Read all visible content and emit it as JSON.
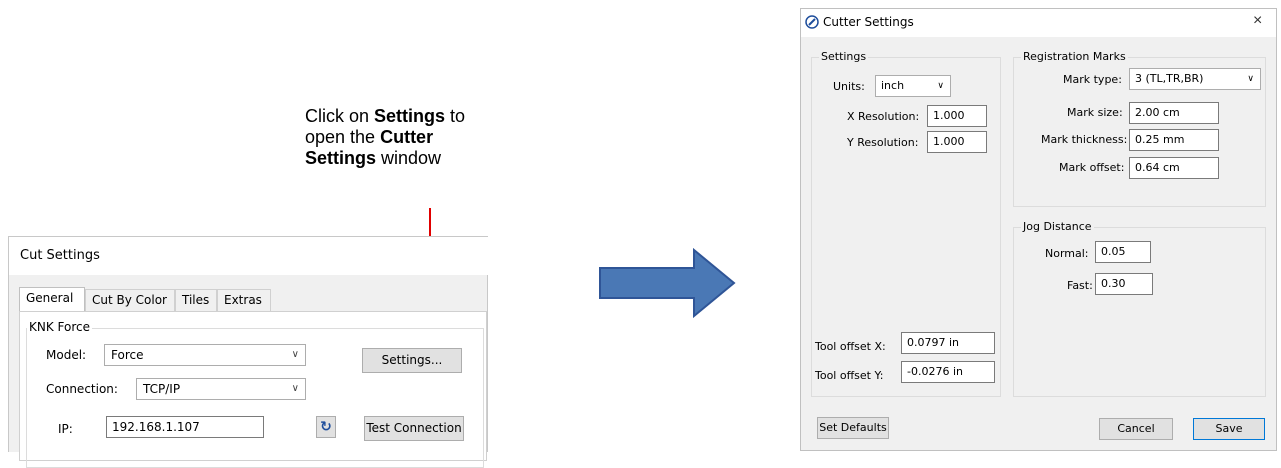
{
  "annotation": {
    "line1_pre": "Click on ",
    "line1_bold": "Settings",
    "line1_post": " to",
    "line2_pre": "open the ",
    "line2_bold": "Cutter",
    "line3_bold": "Settings",
    "line3_post": " window",
    "arrow_color": "#e00000"
  },
  "big_arrow_color": "#4a78b5",
  "cut_settings": {
    "title": "Cut Settings",
    "tabs": [
      "General",
      "Cut By Color",
      "Tiles",
      "Extras"
    ],
    "group_label": "KNK Force",
    "model_label": "Model:",
    "model_value": "Force",
    "settings_button": "Settings...",
    "connection_label": "Connection:",
    "connection_value": "TCP/IP",
    "ip_label": "IP:",
    "ip_value": "192.168.1.107",
    "refresh_icon": "refresh-icon",
    "test_button": "Test Connection"
  },
  "cutter_settings": {
    "title": "Cutter Settings",
    "close_glyph": "×",
    "settings_group": "Settings",
    "units_label": "Units:",
    "units_value": "inch",
    "x_res_label": "X Resolution:",
    "x_res_value": "1.000",
    "y_res_label": "Y Resolution:",
    "y_res_value": "1.000",
    "tool_offset_x_label": "Tool offset X:",
    "tool_offset_x_value": "0.0797 in",
    "tool_offset_y_label": "Tool offset Y:",
    "tool_offset_y_value": "-0.0276 in",
    "reg_group": "Registration Marks",
    "mark_type_label": "Mark type:",
    "mark_type_value": "3 (TL,TR,BR)",
    "mark_size_label": "Mark size:",
    "mark_size_value": "2.00 cm",
    "mark_thickness_label": "Mark thickness:",
    "mark_thickness_value": "0.25 mm",
    "mark_offset_label": "Mark offset:",
    "mark_offset_value": "0.64 cm",
    "jog_group": "Jog Distance",
    "normal_label": "Normal:",
    "normal_value": "0.05",
    "fast_label": "Fast:",
    "fast_value": "0.30",
    "set_defaults": "Set Defaults",
    "cancel": "Cancel",
    "save": "Save"
  }
}
